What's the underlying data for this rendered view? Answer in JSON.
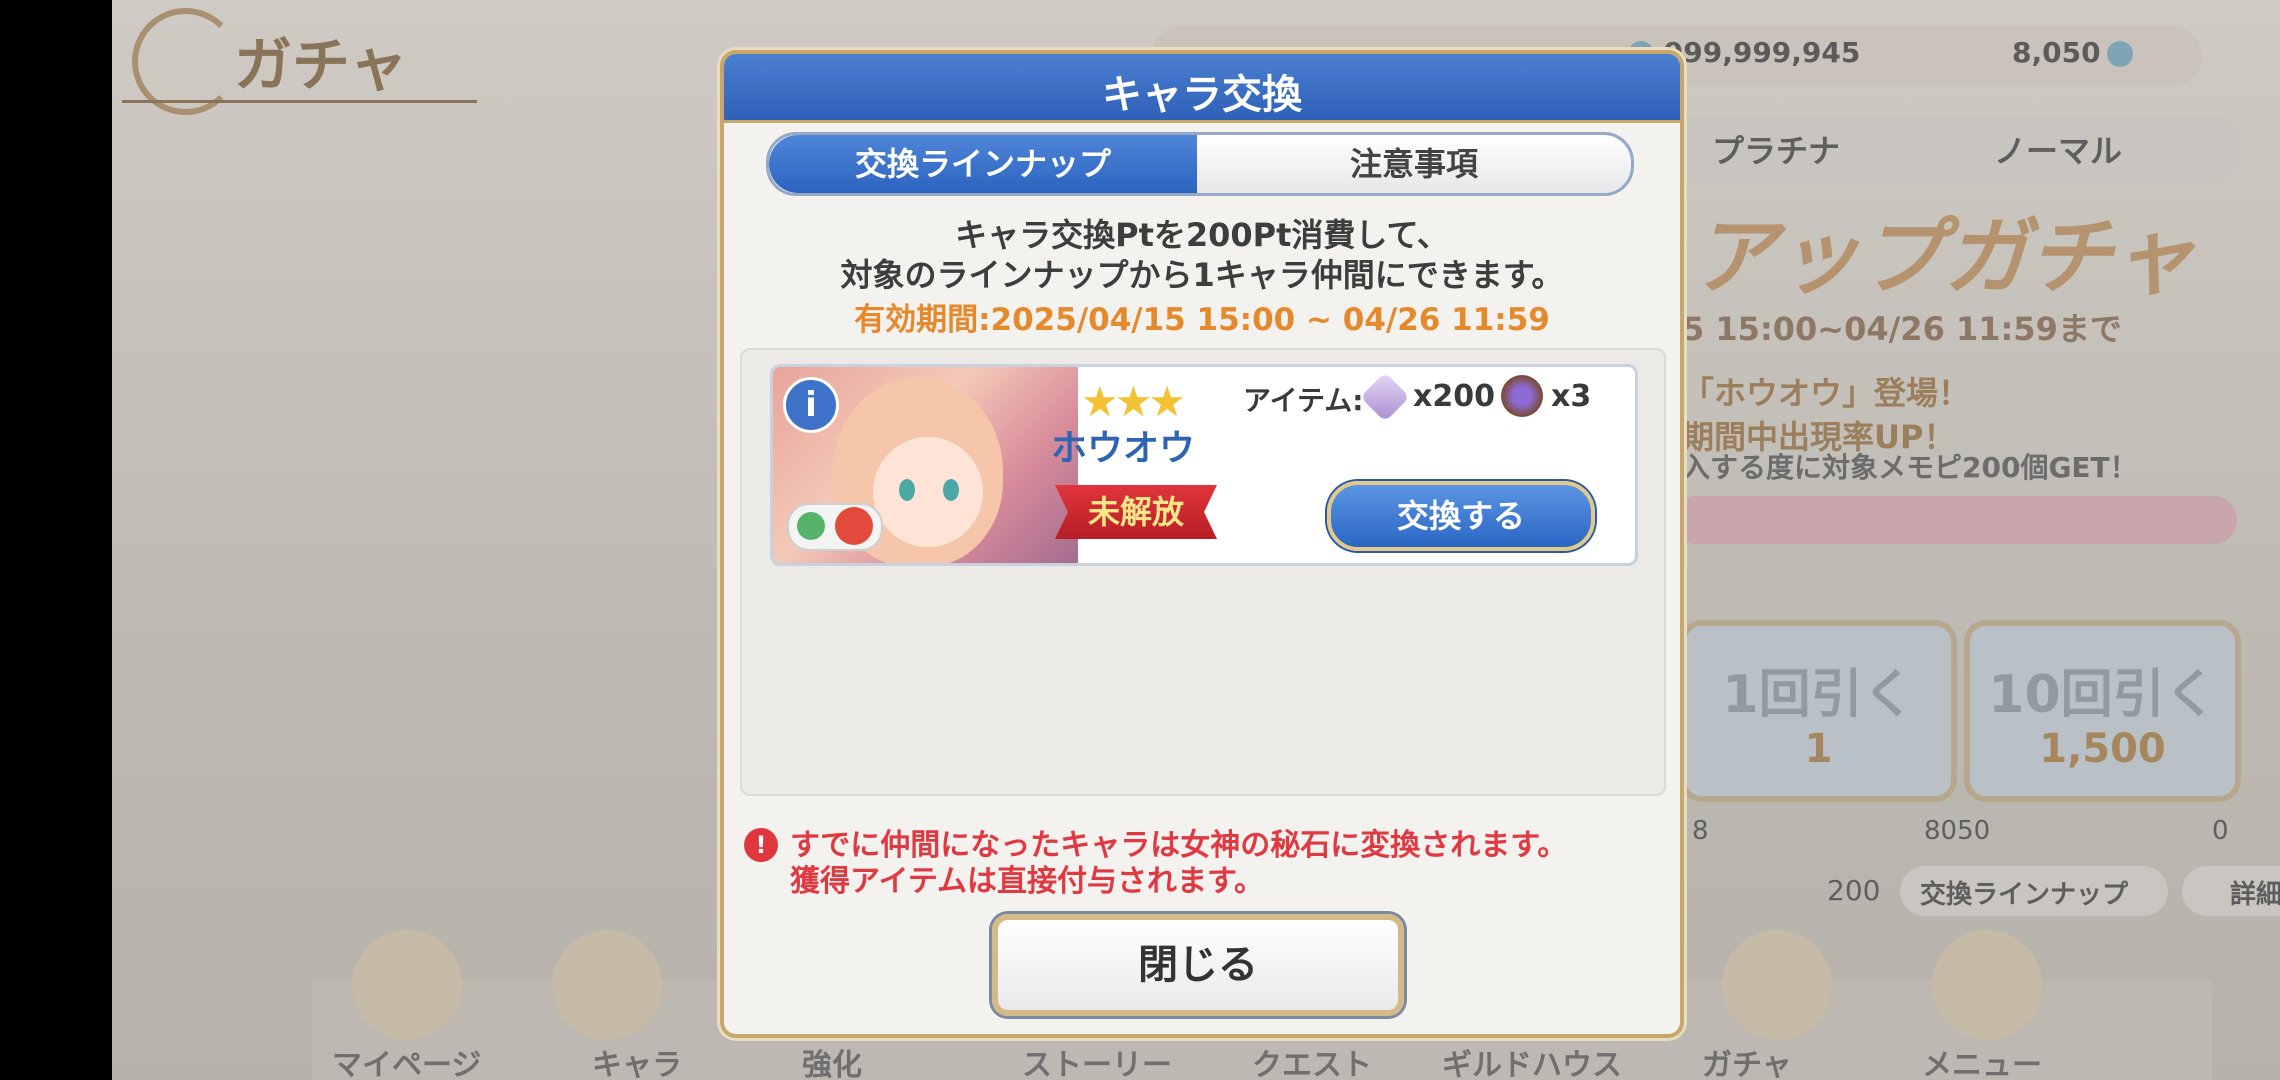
{
  "background": {
    "screen_title": "ガチャ",
    "currency": {
      "free_gems": "999,999,945",
      "paid_gems": "8,050"
    },
    "gacha_tabs": [
      "プラチナ",
      "ノーマル"
    ],
    "banner_title": "アップガチャ",
    "banner_period": "5 15:00~04/26 11:59まで",
    "banner_desc_1": "「ホウオウ」登場！",
    "banner_desc_2": "期間中出現率UP！",
    "banner_desc_3": "入する度に対象メモピ200個GET！",
    "pull_1_label": "1回引く",
    "pull_1_cost": "1",
    "pull_10_label": "10回引く",
    "pull_10_cost": "1,500",
    "stat_a": "8",
    "stat_b": "8050",
    "stat_c": "0",
    "pt_count": "200",
    "exchange_lineup_label": "交換ラインナップ",
    "detail_label": "詳細",
    "nav": [
      "マイページ",
      "キャラ",
      "強化",
      "ストーリー",
      "クエスト",
      "ギルドハウス",
      "ガチャ",
      "メニュー"
    ]
  },
  "modal": {
    "title": "キャラ交換",
    "tabs": {
      "lineup": "交換ラインナップ",
      "notes": "注意事項"
    },
    "description_line1": "キャラ交換Ptを200Pt消費して、",
    "description_line2": "対象のラインナップから1キャラ仲間にできます。",
    "period": "有効期間:2025/04/15 15:00 ~ 04/26 11:59",
    "character": {
      "name": "ホウオウ",
      "stars": "★★★",
      "status": "未解放",
      "item_label": "アイテム:",
      "item1_qty": "x200",
      "item2_qty": "x3",
      "exchange_button": "交換する",
      "info_icon": "i"
    },
    "warning_line1": "すでに仲間になったキャラは女神の秘石に変換されます。",
    "warning_line2": "獲得アイテムは直接付与されます。",
    "close_button": "閉じる"
  }
}
